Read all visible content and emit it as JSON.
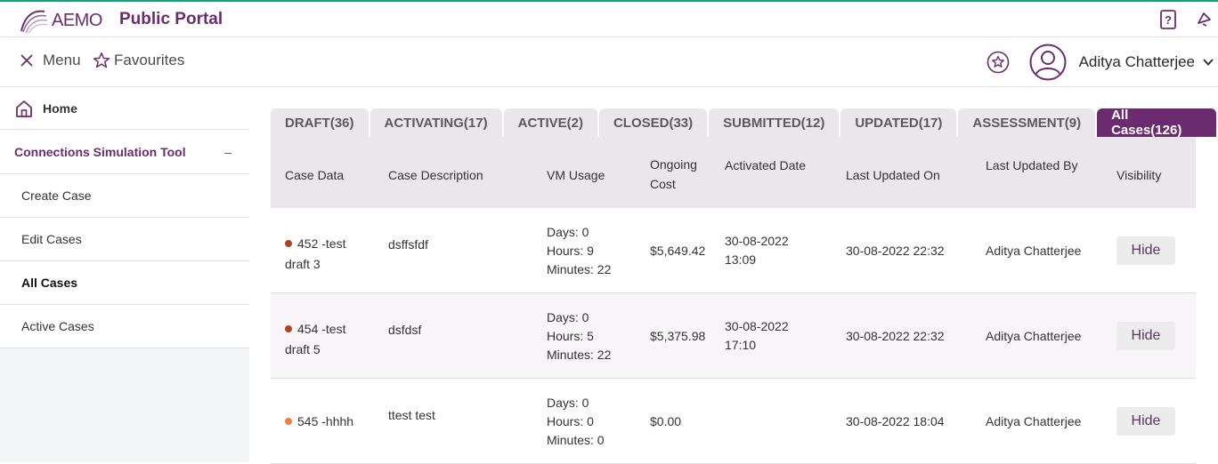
{
  "header": {
    "logo_text": "AEMO",
    "portal_title": "Public Portal"
  },
  "subbar": {
    "menu_label": "Menu",
    "favourites_label": "Favourites",
    "user_name": "Aditya Chatterjee"
  },
  "sidebar": {
    "home_label": "Home",
    "section_label": "Connections Simulation Tool",
    "section_toggle": "–",
    "items": [
      {
        "label": "Create Case"
      },
      {
        "label": "Edit Cases"
      },
      {
        "label": "All Cases"
      },
      {
        "label": "Active Cases"
      }
    ]
  },
  "tabs": [
    {
      "label": "DRAFT(36)"
    },
    {
      "label": "ACTIVATING(17)"
    },
    {
      "label": "ACTIVE(2)"
    },
    {
      "label": "CLOSED(33)"
    },
    {
      "label": "SUBMITTED(12)"
    },
    {
      "label": "UPDATED(17)"
    },
    {
      "label": "ASSESSMENT(9)"
    },
    {
      "label": "All Cases(126)"
    }
  ],
  "table": {
    "headers": {
      "case_data": "Case Data",
      "case_description": "Case Description",
      "vm_usage": "VM Usage",
      "ongoing_cost_1": "Ongoing",
      "ongoing_cost_2": "Cost",
      "activated_date": "Activated Date",
      "last_updated_on": "Last Updated On",
      "last_updated_by": "Last Updated By",
      "visibility": "Visibility"
    },
    "rows": [
      {
        "case_line1": "452 -test",
        "case_line2": "draft 3",
        "status_color": "#b5421f",
        "description": "dsffsfdf",
        "days": "Days: 0",
        "hours": "Hours: 9",
        "minutes": "Minutes: 22",
        "cost": "$5,649.42",
        "activated_date": "30-08-2022",
        "activated_time": "13:09",
        "last_updated_on": "30-08-2022 22:32",
        "last_updated_by": "Aditya Chatterjee",
        "visibility_button": "Hide"
      },
      {
        "case_line1": "454 -test",
        "case_line2": "draft 5",
        "status_color": "#b5421f",
        "description": "dsfdsf",
        "days": "Days: 0",
        "hours": "Hours: 5",
        "minutes": "Minutes: 22",
        "cost": "$5,375.98",
        "activated_date": "30-08-2022",
        "activated_time": "17:10",
        "last_updated_on": "30-08-2022 22:32",
        "last_updated_by": "Aditya Chatterjee",
        "visibility_button": "Hide"
      },
      {
        "case_line1": "545 -hhhh",
        "case_line2": "",
        "status_color": "#e8823e",
        "description": "ttest test",
        "days": "Days: 0",
        "hours": "Hours: 0",
        "minutes": "Minutes: 0",
        "cost": "$0.00",
        "activated_date": "",
        "activated_time": "",
        "last_updated_on": "30-08-2022 18:04",
        "last_updated_by": "Aditya Chatterjee",
        "visibility_button": "Hide"
      }
    ]
  },
  "colors": {
    "brand": "#6b2c6f",
    "top_accent": "#1a9e7a"
  }
}
